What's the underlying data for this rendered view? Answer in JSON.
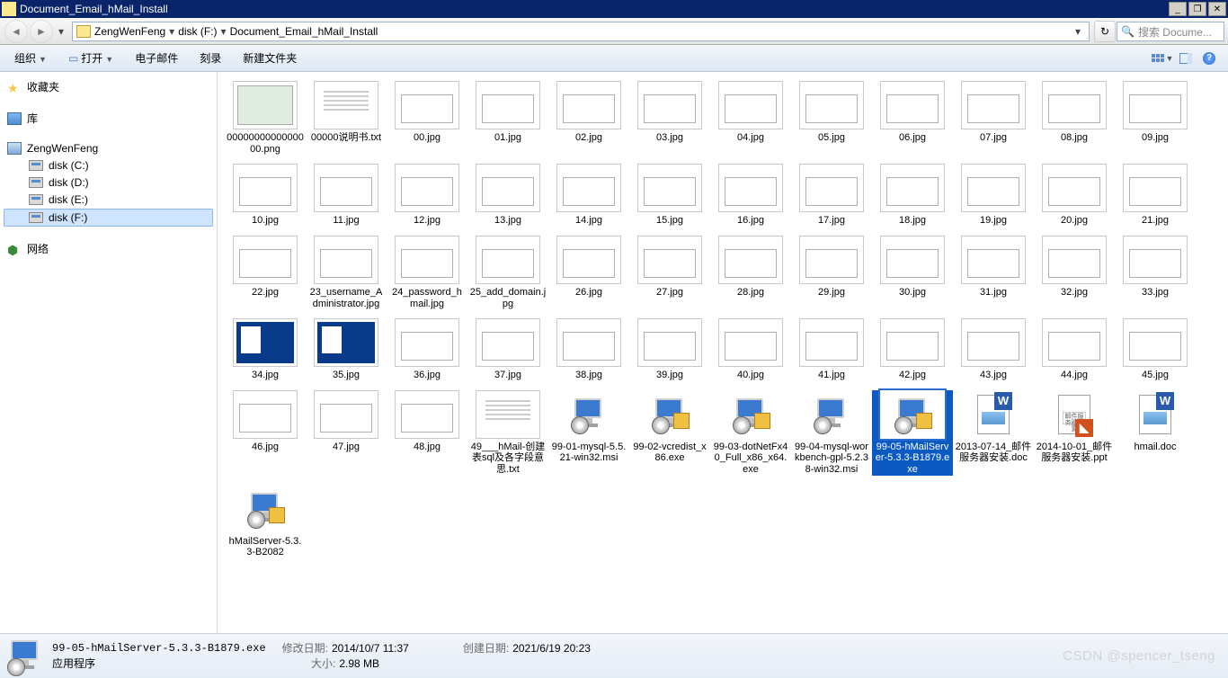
{
  "window": {
    "title": "Document_Email_hMail_Install"
  },
  "breadcrumb": {
    "parts": [
      "ZengWenFeng",
      "disk (F:)",
      "Document_Email_hMail_Install"
    ]
  },
  "search": {
    "placeholder": "搜索 Docume..."
  },
  "toolbar": {
    "organize": "组织",
    "open": "打开",
    "email": "电子邮件",
    "burn": "刻录",
    "newfolder": "新建文件夹"
  },
  "sidebar": {
    "favorites": "收藏夹",
    "library": "库",
    "computer": "ZengWenFeng",
    "disks": [
      "disk (C:)",
      "disk (D:)",
      "disk (E:)",
      "disk (F:)"
    ],
    "selected_disk_index": 3,
    "network": "网络"
  },
  "files": [
    {
      "name": "0000000000000000.png",
      "t": "img"
    },
    {
      "name": "00000说明书.txt",
      "t": "txt"
    },
    {
      "name": "00.jpg",
      "t": "win"
    },
    {
      "name": "01.jpg",
      "t": "win"
    },
    {
      "name": "02.jpg",
      "t": "win"
    },
    {
      "name": "03.jpg",
      "t": "win"
    },
    {
      "name": "04.jpg",
      "t": "win"
    },
    {
      "name": "05.jpg",
      "t": "win"
    },
    {
      "name": "06.jpg",
      "t": "win"
    },
    {
      "name": "07.jpg",
      "t": "win"
    },
    {
      "name": "08.jpg",
      "t": "win"
    },
    {
      "name": "09.jpg",
      "t": "win"
    },
    {
      "name": "10.jpg",
      "t": "win"
    },
    {
      "name": "11.jpg",
      "t": "win"
    },
    {
      "name": "12.jpg",
      "t": "win"
    },
    {
      "name": "13.jpg",
      "t": "win"
    },
    {
      "name": "14.jpg",
      "t": "win"
    },
    {
      "name": "15.jpg",
      "t": "win"
    },
    {
      "name": "16.jpg",
      "t": "win"
    },
    {
      "name": "17.jpg",
      "t": "win"
    },
    {
      "name": "18.jpg",
      "t": "win"
    },
    {
      "name": "19.jpg",
      "t": "win"
    },
    {
      "name": "20.jpg",
      "t": "win"
    },
    {
      "name": "21.jpg",
      "t": "win"
    },
    {
      "name": "22.jpg",
      "t": "win"
    },
    {
      "name": "23_username_Administrator.jpg",
      "t": "win"
    },
    {
      "name": "24_password_hmail.jpg",
      "t": "win"
    },
    {
      "name": "25_add_domain.jpg",
      "t": "win"
    },
    {
      "name": "26.jpg",
      "t": "win"
    },
    {
      "name": "27.jpg",
      "t": "win"
    },
    {
      "name": "28.jpg",
      "t": "win"
    },
    {
      "name": "29.jpg",
      "t": "win"
    },
    {
      "name": "30.jpg",
      "t": "win"
    },
    {
      "name": "31.jpg",
      "t": "win"
    },
    {
      "name": "32.jpg",
      "t": "win"
    },
    {
      "name": "33.jpg",
      "t": "win"
    },
    {
      "name": "34.jpg",
      "t": "blue"
    },
    {
      "name": "35.jpg",
      "t": "blue"
    },
    {
      "name": "36.jpg",
      "t": "win"
    },
    {
      "name": "37.jpg",
      "t": "win"
    },
    {
      "name": "38.jpg",
      "t": "win"
    },
    {
      "name": "39.jpg",
      "t": "win"
    },
    {
      "name": "40.jpg",
      "t": "win"
    },
    {
      "name": "41.jpg",
      "t": "win"
    },
    {
      "name": "42.jpg",
      "t": "win"
    },
    {
      "name": "43.jpg",
      "t": "win"
    },
    {
      "name": "44.jpg",
      "t": "win"
    },
    {
      "name": "45.jpg",
      "t": "win"
    },
    {
      "name": "46.jpg",
      "t": "win"
    },
    {
      "name": "47.jpg",
      "t": "win"
    },
    {
      "name": "48.jpg",
      "t": "win"
    },
    {
      "name": "49___hMail-创建表sql及各字段意思.txt",
      "t": "txt"
    },
    {
      "name": "99-01-mysql-5.5.21-win32.msi",
      "t": "msi"
    },
    {
      "name": "99-02-vcredist_x86.exe",
      "t": "exe"
    },
    {
      "name": "99-03-dotNetFx40_Full_x86_x64.exe",
      "t": "exe"
    },
    {
      "name": "99-04-mysql-workbench-gpl-5.2.38-win32.msi",
      "t": "msi"
    },
    {
      "name": "99-05-hMailServer-5.3.3-B1879.exe",
      "t": "exe",
      "selected": true
    },
    {
      "name": "2013-07-14_邮件服务器安装.doc",
      "t": "doc"
    },
    {
      "name": "2014-10-01_邮件服务器安装.ppt",
      "t": "ppt"
    },
    {
      "name": "hmail.doc",
      "t": "doc"
    },
    {
      "name": "hMailServer-5.3.3-B2082",
      "t": "exe"
    }
  ],
  "details": {
    "filename": "99-05-hMailServer-5.3.3-B1879.exe",
    "type": "应用程序",
    "mod_label": "修改日期:",
    "mod_value": "2014/10/7 11:37",
    "create_label": "创建日期:",
    "create_value": "2021/6/19 20:23",
    "size_label": "大小:",
    "size_value": "2.98 MB"
  },
  "watermark": "CSDN @spencer_tseng"
}
